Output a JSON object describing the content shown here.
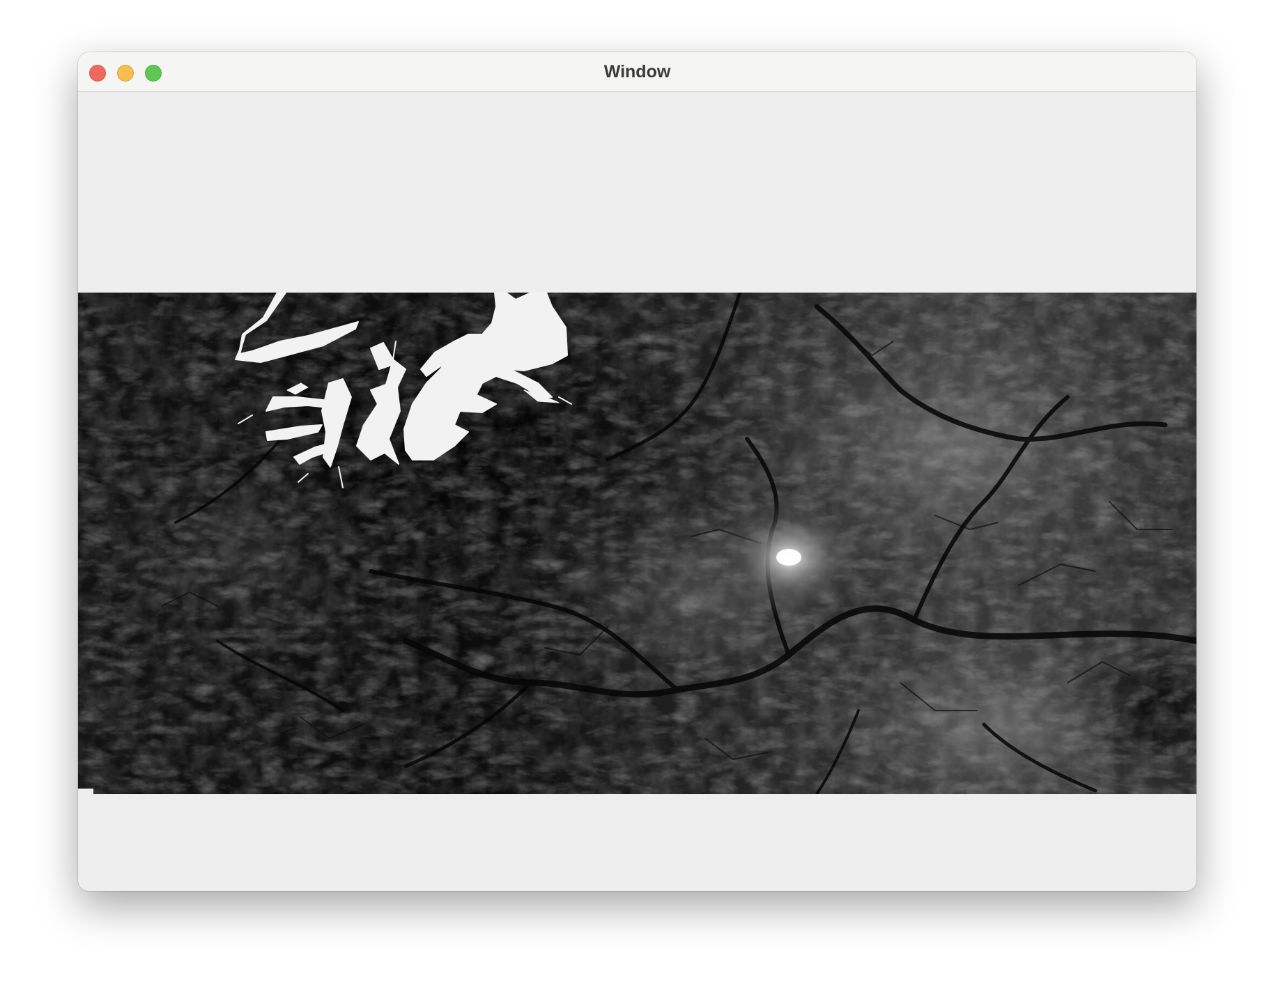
{
  "window": {
    "title": "Window",
    "controls": [
      {
        "name": "close-button",
        "color": "#ee6a5f"
      },
      {
        "name": "minimize-button",
        "color": "#f5be4f"
      },
      {
        "name": "zoom-button",
        "color": "#62c655"
      }
    ]
  },
  "content": {
    "image": {
      "kind": "grayscale elevation raster",
      "icon": "terrain-heightmap",
      "colors": {
        "low": "#050505",
        "high": "#e6e6e6",
        "water": "#f2f2f2",
        "background": "#eeeeee"
      }
    }
  }
}
